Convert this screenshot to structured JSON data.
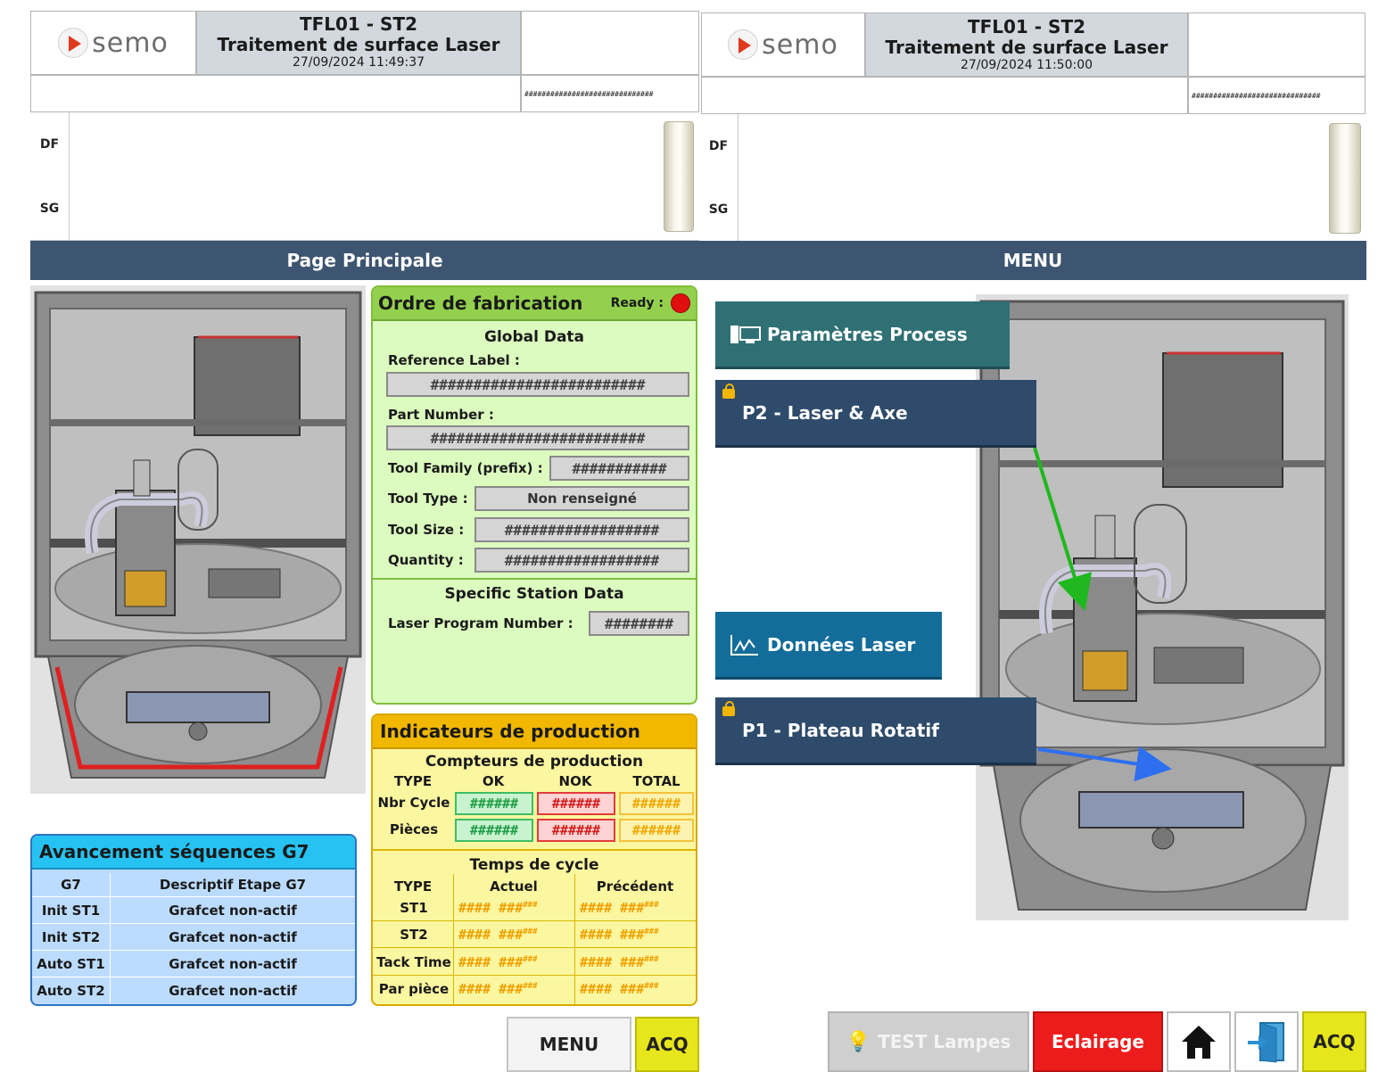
{
  "brand": {
    "logo_text": "semo"
  },
  "left": {
    "header": {
      "title_line1": "TFL01 - ST2",
      "title_line2": "Traitement de surface Laser",
      "timestamp": "27/09/2024 11:49:37",
      "hash_strip": "##############################"
    },
    "side_labels": {
      "df": "DF",
      "sg": "SG"
    },
    "page_title": "Page Principale",
    "ordre": {
      "title": "Ordre de fabrication",
      "ready_label": "Ready :",
      "ready_color": "#e01010",
      "global_title": "Global Data",
      "reference_label": "Reference Label :",
      "reference_value": "#########################",
      "part_number_label": "Part Number :",
      "part_number_value": "#########################",
      "tool_family_label": "Tool Family (prefix) :",
      "tool_family_value": "###########",
      "tool_type_label": "Tool Type :",
      "tool_type_value": "Non renseigné",
      "tool_size_label": "Tool Size :",
      "tool_size_value": "##################",
      "quantity_label": "Quantity :",
      "quantity_value": "##################",
      "specific_title": "Specific Station Data",
      "laser_prog_label": "Laser Program Number :",
      "laser_prog_value": "########"
    },
    "indicateurs": {
      "title": "Indicateurs de production",
      "compteurs_title": "Compteurs de production",
      "col_type": "TYPE",
      "col_ok": "OK",
      "col_nok": "NOK",
      "col_total": "TOTAL",
      "rows": [
        {
          "label": "Nbr Cycle",
          "ok": "######",
          "nok": "######",
          "total": "######"
        },
        {
          "label": "Pièces",
          "ok": "######",
          "nok": "######",
          "total": "######"
        }
      ],
      "temps_title": "Temps de cycle",
      "col_actuel": "Actuel",
      "col_precedent": "Précédent",
      "time_rows": [
        {
          "label": "ST1",
          "actuel": "#### ###",
          "actuel_sup": "###",
          "prec": "#### ###",
          "prec_sup": "###"
        },
        {
          "label": "ST2",
          "actuel": "#### ###",
          "actuel_sup": "###",
          "prec": "#### ###",
          "prec_sup": "###"
        },
        {
          "label": "Tack Time",
          "actuel": "#### ###",
          "actuel_sup": "###",
          "prec": "#### ###",
          "prec_sup": "###"
        },
        {
          "label": "Par pièce",
          "actuel": "#### ###",
          "actuel_sup": "###",
          "prec": "#### ###",
          "prec_sup": "###"
        }
      ]
    },
    "avancement": {
      "title": "Avancement séquences G7",
      "col_g7": "G7",
      "col_desc": "Descriptif Etape G7",
      "rows": [
        {
          "g7": "Init ST1",
          "desc": "Grafcet non-actif"
        },
        {
          "g7": "Init ST2",
          "desc": "Grafcet non-actif"
        },
        {
          "g7": "Auto ST1",
          "desc": "Grafcet non-actif"
        },
        {
          "g7": "Auto ST2",
          "desc": "Grafcet non-actif"
        }
      ]
    },
    "buttons": {
      "menu": "MENU",
      "acq": "ACQ"
    }
  },
  "right": {
    "header": {
      "title_line1": "TFL01 - ST2",
      "title_line2": "Traitement de surface Laser",
      "timestamp": "27/09/2024 11:50:00",
      "hash_strip": "##############################"
    },
    "side_labels": {
      "df": "DF",
      "sg": "SG"
    },
    "page_title": "MENU",
    "menu_items": {
      "params": "Paramètres Process",
      "p2": "P2 - Laser & Axe",
      "donnees": "Données Laser",
      "p1": "P1 - Plateau Rotatif"
    },
    "buttons": {
      "test": "TEST Lampes",
      "eclairage": "Eclairage",
      "acq": "ACQ"
    },
    "arrow_colors": {
      "p2": "#1fb81f",
      "p1": "#2e6ff0"
    }
  }
}
